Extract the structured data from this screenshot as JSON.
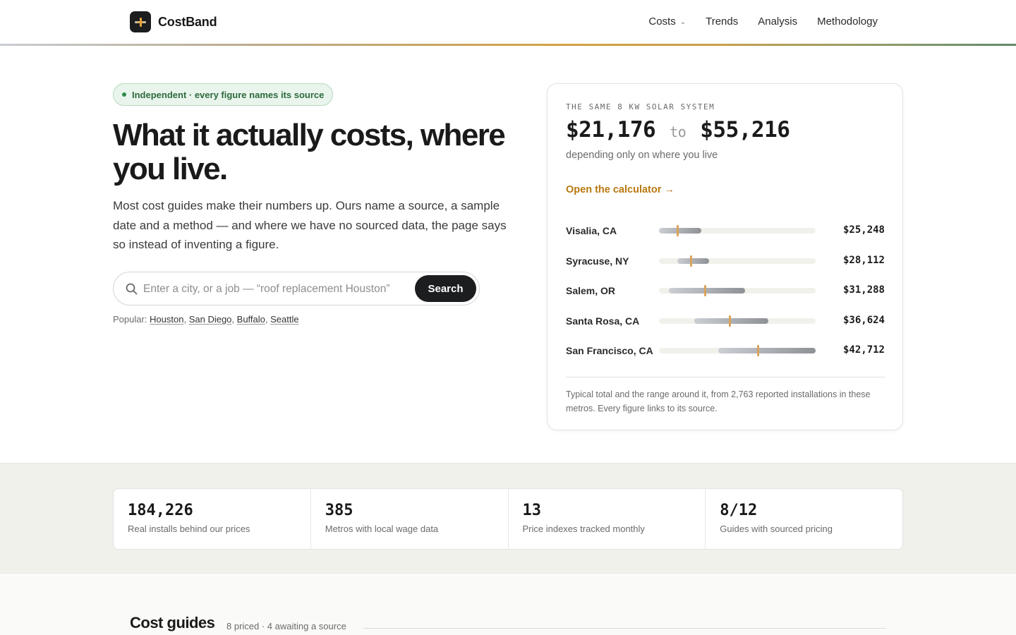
{
  "brand": {
    "name": "CostBand"
  },
  "nav": {
    "items": [
      {
        "label": "Costs",
        "has_dropdown": true
      },
      {
        "label": "Trends"
      },
      {
        "label": "Analysis"
      },
      {
        "label": "Methodology"
      }
    ]
  },
  "hero": {
    "badge": "Independent · every figure names its source",
    "title": "What it actually costs, where you live.",
    "subtitle": "Most cost guides make their numbers up. Ours name a source, a sample date and a method — and where we have no sourced data, the page says so instead of inventing a figure.",
    "search": {
      "placeholder": "Enter a city, or a job — “roof replacement Houston”",
      "value": "",
      "button_label": "Search"
    },
    "popular_label": "Popular:",
    "popular": [
      "Houston",
      "San Diego",
      "Buffalo",
      "Seattle"
    ]
  },
  "card": {
    "eyebrow": "THE SAME 8 KW SOLAR SYSTEM",
    "range_low": "$21,176",
    "range_word": "to",
    "range_high": "$55,216",
    "subtitle": "depending only on where you live",
    "link": "Open the calculator →",
    "scale": {
      "min": 21176,
      "max": 55216
    },
    "rows": [
      {
        "city": "Visalia, CA",
        "price": "$25,248",
        "typical": 25248,
        "low": 21176,
        "high": 30300
      },
      {
        "city": "Syracuse, NY",
        "price": "$28,112",
        "typical": 28112,
        "low": 25100,
        "high": 32100
      },
      {
        "city": "Salem, OR",
        "price": "$31,288",
        "typical": 31288,
        "low": 23300,
        "high": 39900
      },
      {
        "city": "Santa Rosa, CA",
        "price": "$36,624",
        "typical": 36624,
        "low": 28800,
        "high": 45000
      },
      {
        "city": "San Francisco, CA",
        "price": "$42,712",
        "typical": 42712,
        "low": 34000,
        "high": 55216
      }
    ],
    "note": "Typical total and the range around it, from 2,763 reported installations in these metros. Every figure links to its source."
  },
  "stats": [
    {
      "value": "184,226",
      "label": "Real installs behind our prices"
    },
    {
      "value": "385",
      "label": "Metros with local wage data"
    },
    {
      "value": "13",
      "label": "Price indexes tracked monthly"
    },
    {
      "value": "8/12",
      "label": "Guides with sourced pricing"
    }
  ],
  "guides": {
    "title": "Cost guides",
    "meta": "8 priced · 4 awaiting a source"
  },
  "colors": {
    "accent": "#b8780f",
    "marker": "#d9a45a",
    "badge_green": "#2d6a3e",
    "dark": "#1c1d1f"
  }
}
